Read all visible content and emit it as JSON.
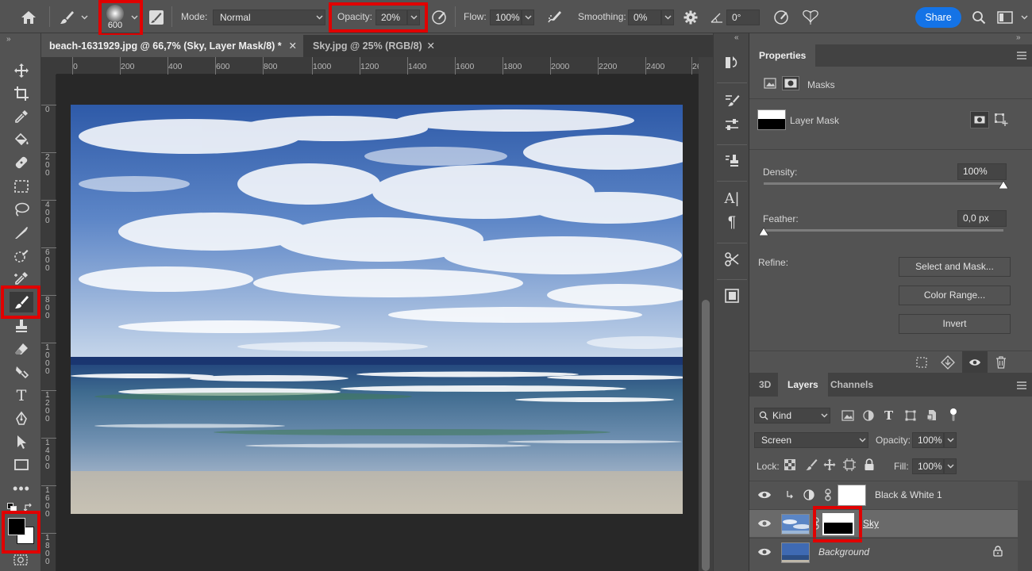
{
  "options": {
    "brush_size": "600",
    "mode_label": "Mode:",
    "mode_value": "Normal",
    "opacity_label": "Opacity:",
    "opacity_value": "20%",
    "flow_label": "Flow:",
    "flow_value": "100%",
    "smoothing_label": "Smoothing:",
    "smoothing_value": "0%",
    "angle_value": "0°",
    "share_label": "Share",
    "icons": [
      "home-icon",
      "brush-icon",
      "brush-settings-icon",
      "airbrush-icon",
      "pressure-icon",
      "gear-icon",
      "angle-icon",
      "symmetry-icon",
      "search-icon",
      "workspace-icon"
    ]
  },
  "tabs": [
    {
      "label": "beach-1631929.jpg @ 66,7% (Sky, Layer Mask/8) *",
      "active": true
    },
    {
      "label": "Sky.jpg @ 25% (RGB/8)",
      "active": false
    }
  ],
  "ruler": {
    "h_ticks": [
      "0",
      "200",
      "400",
      "600",
      "800",
      "1000",
      "1200",
      "1400",
      "1600",
      "1800",
      "2000",
      "2200",
      "2400",
      "26"
    ],
    "v_ticks": [
      "0",
      "200",
      "400",
      "600",
      "800",
      "1000",
      "1200",
      "1400",
      "1600",
      "1800"
    ]
  },
  "tools": [
    "move-icon",
    "crop-icon",
    "eyedropper-icon",
    "paint-bucket-icon",
    "healing-brush-icon",
    "marquee-icon",
    "lasso-icon",
    "pen-path-icon",
    "quick-selection-icon",
    "color-sampler-icon",
    "brush-icon",
    "stamp-icon",
    "eraser-icon",
    "smudge-icon",
    "type-icon",
    "pen-icon",
    "path-selection-icon",
    "rectangle-icon",
    "more-tools-icon"
  ],
  "properties": {
    "title": "Properties",
    "section": "Masks",
    "mask_name": "Layer Mask",
    "density_label": "Density:",
    "density_value": "100%",
    "density_fraction": 1.0,
    "feather_label": "Feather:",
    "feather_value": "0,0 px",
    "feather_fraction": 0.0,
    "refine_label": "Refine:",
    "btn_select_mask": "Select and Mask...",
    "btn_color_range": "Color Range...",
    "btn_invert": "Invert"
  },
  "layers_panel": {
    "tabs": [
      "3D",
      "Layers",
      "Channels"
    ],
    "active_tab": "Layers",
    "filter_kind": "Kind",
    "blend_mode": "Screen",
    "opacity_label": "Opacity:",
    "opacity_value": "100%",
    "lock_label": "Lock:",
    "fill_label": "Fill:",
    "fill_value": "100%",
    "layers": [
      {
        "name": "Black & White 1",
        "type": "adjustment",
        "selected": false
      },
      {
        "name": "Sky",
        "type": "masked",
        "selected": true
      },
      {
        "name": "Background",
        "type": "background",
        "selected": false
      }
    ]
  },
  "colors": {
    "accent_blue": "#1473e6",
    "highlight_red": "#e00000",
    "panel_bg": "#535353",
    "canvas_bg": "#282828"
  }
}
